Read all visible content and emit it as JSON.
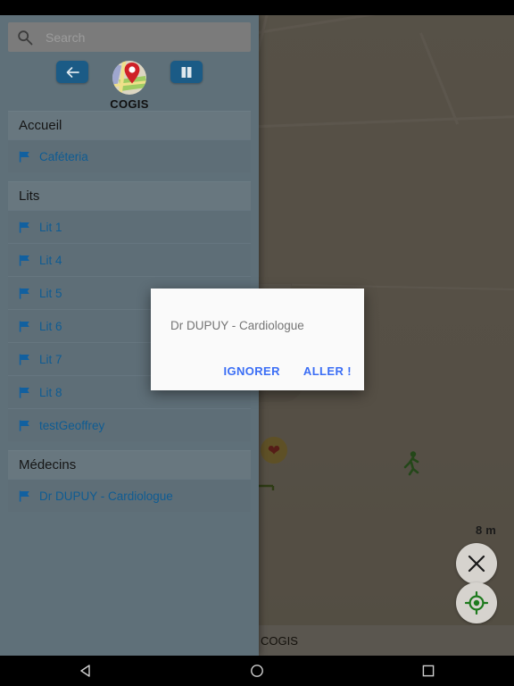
{
  "app": {
    "name": "COGIS",
    "bottom_bar_label": "COGIS"
  },
  "search": {
    "placeholder": "Search",
    "value": "",
    "icon": "search-icon"
  },
  "header": {
    "back_icon": "arrow-left-icon",
    "map_icon": "map-book-icon",
    "logo_icon": "map-pin-logo-icon",
    "title": "COGIS"
  },
  "drawer": {
    "sections": [
      {
        "title": "Accueil",
        "items": [
          {
            "label": "Caféteria",
            "icon": "flag-icon"
          }
        ]
      },
      {
        "title": "Lits",
        "items": [
          {
            "label": "Lit 1",
            "icon": "flag-icon"
          },
          {
            "label": "Lit 4",
            "icon": "flag-icon"
          },
          {
            "label": "Lit 5",
            "icon": "flag-icon"
          },
          {
            "label": "Lit 6",
            "icon": "flag-icon"
          },
          {
            "label": "Lit 7",
            "icon": "flag-icon"
          },
          {
            "label": "Lit 8",
            "icon": "flag-icon"
          },
          {
            "label": "testGeoffrey",
            "icon": "flag-icon"
          }
        ]
      },
      {
        "title": "Médecins",
        "items": [
          {
            "label": "Dr DUPUY - Cardiologue",
            "icon": "flag-icon"
          }
        ]
      }
    ]
  },
  "dialog": {
    "message": "Dr DUPUY - Cardiologue",
    "dismiss_label": "IGNORER",
    "confirm_label": "ALLER !"
  },
  "map": {
    "scale_label": "8 m",
    "close_icon": "close-x-icon",
    "locate_icon": "my-location-icon",
    "pois": [
      {
        "icon": "bed-icon"
      },
      {
        "icon": "heart-cardiology-icon"
      },
      {
        "icon": "running-exit-icon"
      },
      {
        "icon": "bed-icon"
      }
    ]
  },
  "system_nav": {
    "back_icon": "android-back-icon",
    "home_icon": "android-home-icon",
    "recents_icon": "android-recents-icon"
  },
  "colors": {
    "drawer_bg": "#5f7079",
    "accent_blue": "#1b5b86",
    "link_blue": "#0f5c93",
    "dialog_action": "#3b6ef5",
    "locate_green": "#2a8f2a"
  }
}
